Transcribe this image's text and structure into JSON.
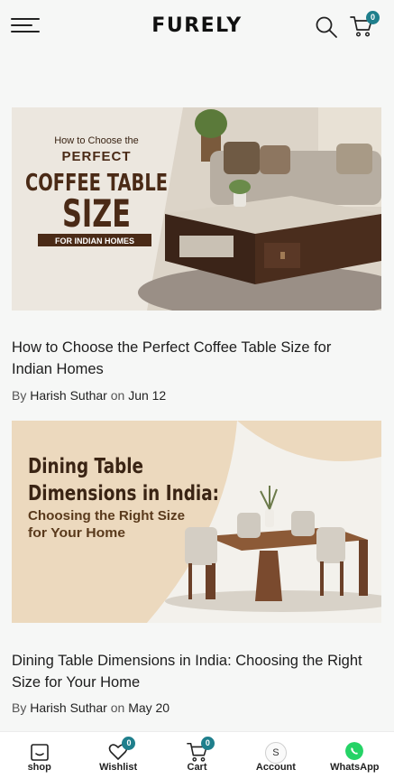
{
  "header": {
    "logo": "FURELY",
    "cart_count": "0"
  },
  "posts": [
    {
      "title": "How to Choose the Perfect Coffee Table Size for Indian Homes",
      "by": "By",
      "author": "Harish Suthar",
      "on": "on",
      "date": "Jun 12",
      "banner": {
        "line1": "How to Choose the",
        "line2": "PERFECT",
        "line3": "COFFEE TABLE",
        "line4": "SIZE",
        "tag": "FOR INDIAN HOMES"
      }
    },
    {
      "title": "Dining Table Dimensions in India: Choosing the Right Size for Your Home",
      "by": "By",
      "author": "Harish Suthar",
      "on": "on",
      "date": "May 20",
      "banner": {
        "line1": "Dining Table",
        "line2": "Dimensions in India:",
        "line3": "Choosing the Right Size",
        "line4": "for Your Home"
      }
    }
  ],
  "bottom_nav": {
    "shop": "shop",
    "wishlist": "Wishlist",
    "wishlist_count": "0",
    "cart": "Cart",
    "cart_count": "0",
    "account": "Account",
    "account_initial": "S",
    "whatsapp": "WhatsApp"
  },
  "colors": {
    "badge": "#1f7f8c",
    "banner1_text": "#4a2a16",
    "banner2_text": "#3a2414",
    "whatsapp": "#25d366"
  }
}
